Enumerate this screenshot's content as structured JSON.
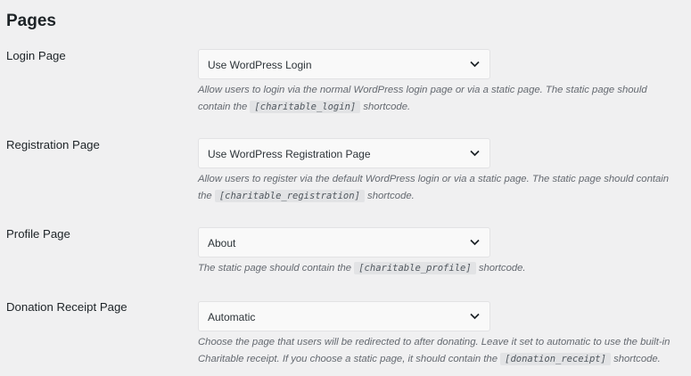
{
  "page": {
    "title": "Pages"
  },
  "rows": [
    {
      "label": "Login Page",
      "value": "Use WordPress Login",
      "desc_pre": "Allow users to login via the normal WordPress login page or via a static page. The static page should contain the",
      "code": "[charitable_login]",
      "desc_post": "shortcode."
    },
    {
      "label": "Registration Page",
      "value": "Use WordPress Registration Page",
      "desc_pre": "Allow users to register via the default WordPress login or via a static page. The static page should contain the",
      "code": "[charitable_registration]",
      "desc_post": "shortcode."
    },
    {
      "label": "Profile Page",
      "value": "About",
      "desc_pre": "The static page should contain the",
      "code": "[charitable_profile]",
      "desc_post": "shortcode."
    },
    {
      "label": "Donation Receipt Page",
      "value": "Automatic",
      "desc_pre": "Choose the page that users will be redirected to after donating. Leave it set to automatic to use the built-in Charitable receipt. If you choose a static page, it should contain the",
      "code": "[donation_receipt]",
      "desc_post": "shortcode."
    }
  ],
  "icons": {
    "dropdown": "chevron-down-icon"
  }
}
